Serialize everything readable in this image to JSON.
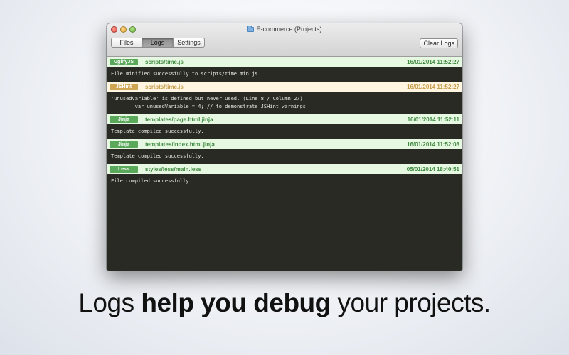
{
  "window": {
    "title": "E-commerce (Projects)",
    "tabs": [
      "Files",
      "Logs",
      "Settings"
    ],
    "active_tab": "Logs",
    "clear_label": "Clear Logs"
  },
  "logs": [
    {
      "tool": "UglifyJS",
      "file": "scripts/time.js",
      "time": "16/01/2014 11:52:27",
      "status": "success",
      "message": "File minified successfully to scripts/time.min.js"
    },
    {
      "tool": "JSHint",
      "file": "scripts/time.js",
      "time": "16/01/2014 11:52:27",
      "status": "warning",
      "message": "'unusedVariable' is defined but never used. (Line 8 / Column 27)\n        var unusedVariable = 4; // to demonstrate JSHint warnings"
    },
    {
      "tool": "Jinja",
      "file": "templates/page.html.jinja",
      "time": "16/01/2014 11:52:11",
      "status": "success",
      "message": "Template compiled successfully."
    },
    {
      "tool": "Jinja",
      "file": "templates/index.html.jinja",
      "time": "16/01/2014 11:52:08",
      "status": "success",
      "message": "Template compiled successfully."
    },
    {
      "tool": "Less",
      "file": "styles/less/main.less",
      "time": "05/01/2014 18:40:51",
      "status": "success",
      "message": "File compiled successfully."
    }
  ],
  "tagline": {
    "pre": "Logs ",
    "bold": "help you debug",
    "post": " your projects."
  },
  "colors": {
    "success": "#5aa85a",
    "warning": "#d0a653",
    "log_bg": "#2a2a24"
  }
}
